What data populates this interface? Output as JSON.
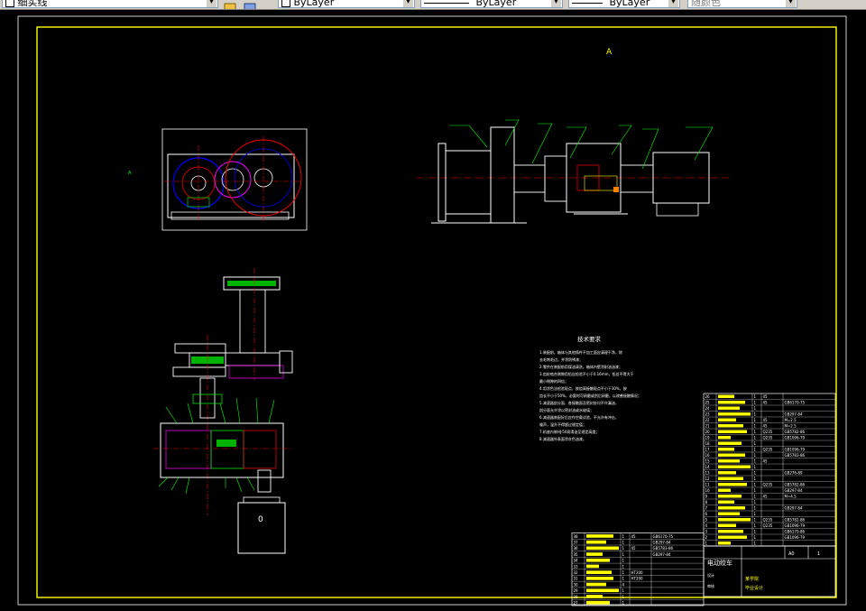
{
  "toolbar": {
    "layer_name": "细实线",
    "color": "ByLayer",
    "linetype": "ByLayer",
    "lineweight": "ByLayer",
    "plotstyle": "随颜色"
  },
  "drawing": {
    "view_label": "A",
    "side_label": "A",
    "motor_label": "0",
    "tech_title": "技术要求",
    "tech_lines": [
      "1.装配前，箱体与其他铸件不加工面应清理干净，除",
      "去毛刺毛边，并涂防锈漆；",
      "2.零件在装配前用煤油清洗，箱体内壁涂耐油油漆；",
      "3.齿轮啮合侧隙用铅丝检验不小于0.16mm，铅丝不得大于",
      "最小侧隙的四倍；",
      "4.用涂色法检验斑点，按齿高接触斑点不小于30%，按",
      "齿长不小于50%，必要时可研磨或刮后研磨，以改善接触情况；",
      "5.减速器剖分面、各接触面及密封处均不许漏油，",
      "剖分面允许涂以密封油或水玻璃；",
      "6.减速器装配好后应作空载试验，不允许有冲击、",
      "噪声，温升不得超过规定值；",
      "7.机座内装HJ-50润滑油至规定高度；",
      "8.减速器外表面涂灰色油漆。"
    ]
  },
  "title_block": {
    "project": "电动绞车",
    "school": "某学院",
    "sheet": "A0",
    "ratio": "1",
    "subtitle": "毕业设计",
    "design": "设计",
    "check": "审核"
  },
  "parts_list": {
    "upper": [
      {
        "no": "26",
        "qty": "1",
        "mat": "45",
        "std": ""
      },
      {
        "no": "25",
        "qty": "1",
        "mat": "45",
        "std": "GB6170-75"
      },
      {
        "no": "24",
        "qty": "1",
        "mat": "",
        "std": ""
      },
      {
        "no": "23",
        "qty": "1",
        "mat": "",
        "std": "GB297-84"
      },
      {
        "no": "22",
        "qty": "1",
        "mat": "45",
        "std": "M=2.5"
      },
      {
        "no": "21",
        "qty": "1",
        "mat": "45",
        "std": "M=2.5"
      },
      {
        "no": "20",
        "qty": "1",
        "mat": "Q235",
        "std": "GB5782-86"
      },
      {
        "no": "19",
        "qty": "1",
        "mat": "Q235",
        "std": "GB1096-79"
      },
      {
        "no": "18",
        "qty": "1",
        "mat": "",
        "std": ""
      },
      {
        "no": "17",
        "qty": "1",
        "mat": "Q235",
        "std": "GB1096-79"
      },
      {
        "no": "16",
        "qty": "1",
        "mat": "",
        "std": "GB5783-86"
      },
      {
        "no": "15",
        "qty": "1",
        "mat": "45",
        "std": ""
      },
      {
        "no": "14",
        "qty": "1",
        "mat": "",
        "std": ""
      },
      {
        "no": "13",
        "qty": "1",
        "mat": "",
        "std": "GB276-89"
      },
      {
        "no": "12",
        "qty": "1",
        "mat": "",
        "std": ""
      },
      {
        "no": "11",
        "qty": "1",
        "mat": "Q235",
        "std": "GB5782-86"
      },
      {
        "no": "10",
        "qty": "1",
        "mat": "",
        "std": "GB297-84"
      },
      {
        "no": "9",
        "qty": "1",
        "mat": "45",
        "std": "M=4.5"
      },
      {
        "no": "8",
        "qty": "1",
        "mat": "",
        "std": ""
      },
      {
        "no": "7",
        "qty": "1",
        "mat": "",
        "std": "GB297-84"
      },
      {
        "no": "6",
        "qty": "1",
        "mat": "",
        "std": ""
      },
      {
        "no": "5",
        "qty": "1",
        "mat": "Q235",
        "std": "GB5782-86"
      },
      {
        "no": "4",
        "qty": "1",
        "mat": "Q235",
        "std": "GB1096-79"
      },
      {
        "no": "3",
        "qty": "1",
        "mat": "",
        "std": "GB6170-86"
      },
      {
        "no": "2",
        "qty": "1",
        "mat": "",
        "std": "GB1096-79"
      },
      {
        "no": "1",
        "qty": "1",
        "mat": "",
        "std": ""
      }
    ],
    "lower": [
      {
        "no": "38",
        "qty": "1",
        "mat": "45",
        "std": "GB6170-75"
      },
      {
        "no": "37",
        "qty": "1",
        "mat": "",
        "std": "GB297-84"
      },
      {
        "no": "36",
        "qty": "1",
        "mat": "45",
        "std": "GB5783-86"
      },
      {
        "no": "35",
        "qty": "1",
        "mat": "",
        "std": "GB297-84"
      },
      {
        "no": "34",
        "qty": "1",
        "mat": "",
        "std": ""
      },
      {
        "no": "33",
        "qty": "1",
        "mat": "",
        "std": ""
      },
      {
        "no": "32",
        "qty": "1",
        "mat": "HT200",
        "std": ""
      },
      {
        "no": "31",
        "qty": "1",
        "mat": "HT200",
        "std": ""
      },
      {
        "no": "30",
        "qty": "4",
        "mat": "",
        "std": ""
      },
      {
        "no": "29",
        "qty": "1",
        "mat": "",
        "std": ""
      },
      {
        "no": "28",
        "qty": "1",
        "mat": "",
        "std": ""
      },
      {
        "no": "27",
        "qty": "1",
        "mat": "",
        "std": ""
      }
    ]
  },
  "colors": {
    "background": "#000000",
    "border": "#ffff00",
    "outline": "#ffffff",
    "center": "#ff0000",
    "dim": "#00ff00",
    "hidden": "#0000ff",
    "magenta": "#ff00ff"
  }
}
